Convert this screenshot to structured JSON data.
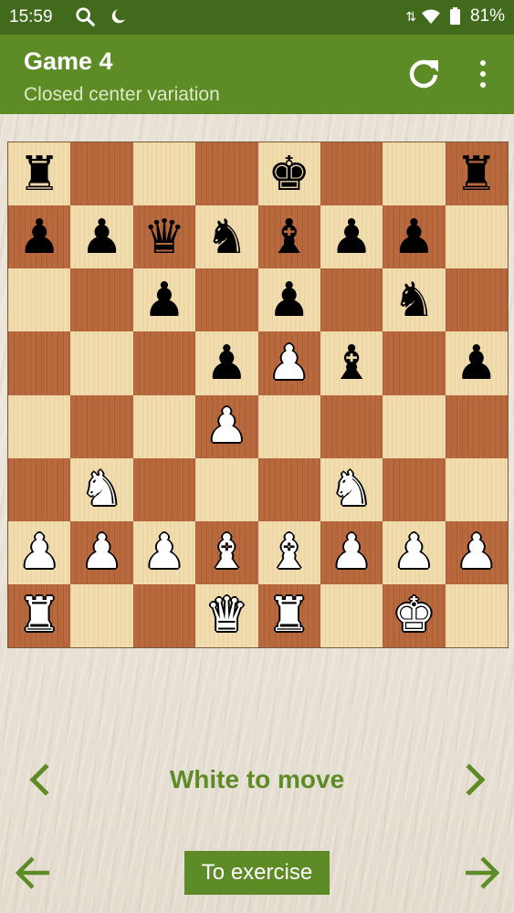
{
  "status_bar": {
    "time": "15:59",
    "battery": "81%",
    "icons_left": [
      "search-icon",
      "moon-icon"
    ],
    "icons_right": [
      "data-arrows-icon",
      "wifi-icon",
      "battery-icon"
    ]
  },
  "app_bar": {
    "title": "Game 4",
    "subtitle": "Closed center variation",
    "actions": [
      "refresh-icon",
      "more-vert-icon"
    ]
  },
  "board": {
    "ranks": [
      [
        "bR",
        "",
        "",
        "",
        "bK",
        "",
        "",
        "bR"
      ],
      [
        "bP",
        "bP",
        "bQ",
        "bN",
        "bB",
        "bP",
        "bP",
        ""
      ],
      [
        "",
        "",
        "bP",
        "",
        "bP",
        "",
        "bN",
        ""
      ],
      [
        "",
        "",
        "",
        "bP",
        "wP",
        "bB",
        "",
        "bP"
      ],
      [
        "",
        "",
        "",
        "wP",
        "",
        "",
        "",
        ""
      ],
      [
        "",
        "wN",
        "",
        "",
        "",
        "wN",
        "",
        ""
      ],
      [
        "wP",
        "wP",
        "wP",
        "wB",
        "wB",
        "wP",
        "wP",
        "wP"
      ],
      [
        "wR",
        "",
        "",
        "wQ",
        "wR",
        "",
        "wK",
        ""
      ]
    ],
    "light_color": "#f1dcae",
    "dark_color": "#b8693d"
  },
  "navigation": {
    "status": "White to move",
    "prev_icon": "chevron-left-icon",
    "next_icon": "chevron-right-icon",
    "back_icon": "arrow-left-icon",
    "forward_icon": "arrow-right-icon"
  },
  "exercise_button": {
    "label": "To exercise"
  },
  "colors": {
    "status_bar": "#426a1c",
    "accent": "#5d8b25",
    "subtitle": "#dcebc6"
  }
}
